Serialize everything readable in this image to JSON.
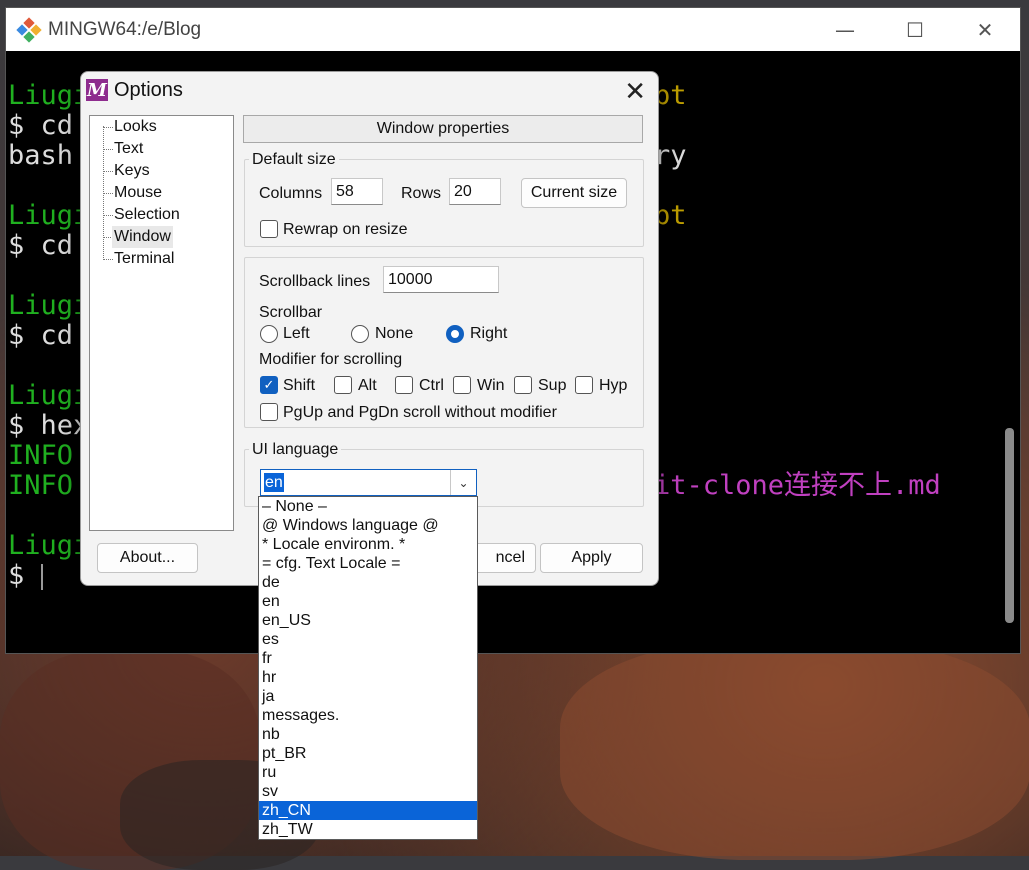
{
  "terminal": {
    "title": "MINGW64:/e/Blog",
    "lines": [
      {
        "a": "Liugi",
        "b": "",
        "c": "pt"
      },
      {
        "a": "$ cd",
        "b": "",
        "c": ""
      },
      {
        "a": "bash",
        "b": "",
        "c": "ry"
      },
      {
        "a": "",
        "b": "",
        "c": ""
      },
      {
        "a": "Liugi",
        "b": "",
        "c": "pt"
      },
      {
        "a": "$ cd",
        "b": "",
        "c": ""
      },
      {
        "a": "",
        "b": "",
        "c": ""
      },
      {
        "a": "Liugi",
        "b": "",
        "c": ""
      },
      {
        "a": "$ cd",
        "b": "",
        "c": ""
      },
      {
        "a": "",
        "b": "",
        "c": ""
      },
      {
        "a": "Liugi",
        "b": "",
        "c": ""
      },
      {
        "a": "$ hex",
        "b": "",
        "c": ""
      },
      {
        "a": "INFO",
        "b": "",
        "c": ""
      },
      {
        "a": "INFO",
        "b": "",
        "c": "it-clone连接不上.md"
      },
      {
        "a": "",
        "b": "",
        "c": ""
      },
      {
        "a": "Liugi",
        "b": "",
        "c": ""
      },
      {
        "a": "$",
        "b": "",
        "c": ""
      }
    ]
  },
  "dialog": {
    "title": "Options",
    "tree": [
      "Looks",
      "Text",
      "Keys",
      "Mouse",
      "Selection",
      "Window",
      "Terminal"
    ],
    "section_title": "Window properties",
    "default_size": {
      "label": "Default size",
      "columns_label": "Columns",
      "columns_value": "58",
      "rows_label": "Rows",
      "rows_value": "20",
      "current_size_button": "Current size",
      "rewrap_label": "Rewrap on resize"
    },
    "scrollback": {
      "lines_label": "Scrollback lines",
      "lines_value": "10000",
      "scrollbar_label": "Scrollbar",
      "left": "Left",
      "none": "None",
      "right": "Right",
      "modifier_label": "Modifier for scrolling",
      "modifiers": [
        "Shift",
        "Alt",
        "Ctrl",
        "Win",
        "Sup",
        "Hyp"
      ],
      "pgup_label": "PgUp and PgDn scroll without modifier"
    },
    "ui_language": {
      "label": "UI language",
      "value": "en",
      "options": [
        "– None –",
        "@ Windows language @",
        "* Locale environm. *",
        "= cfg. Text Locale =",
        "de",
        "en",
        "en_US",
        "es",
        "fr",
        "hr",
        "ja",
        "messages.",
        "nb",
        "pt_BR",
        "ru",
        "sv",
        "zh_CN",
        "zh_TW"
      ],
      "highlighted": "zh_CN"
    },
    "about_button": "About...",
    "cancel_button": "ncel",
    "apply_button": "Apply"
  },
  "colors": {
    "accent": "#0a64d8",
    "terminal_green": "#20b020",
    "terminal_yellow": "#c0a000",
    "terminal_magenta": "#c040c0"
  }
}
